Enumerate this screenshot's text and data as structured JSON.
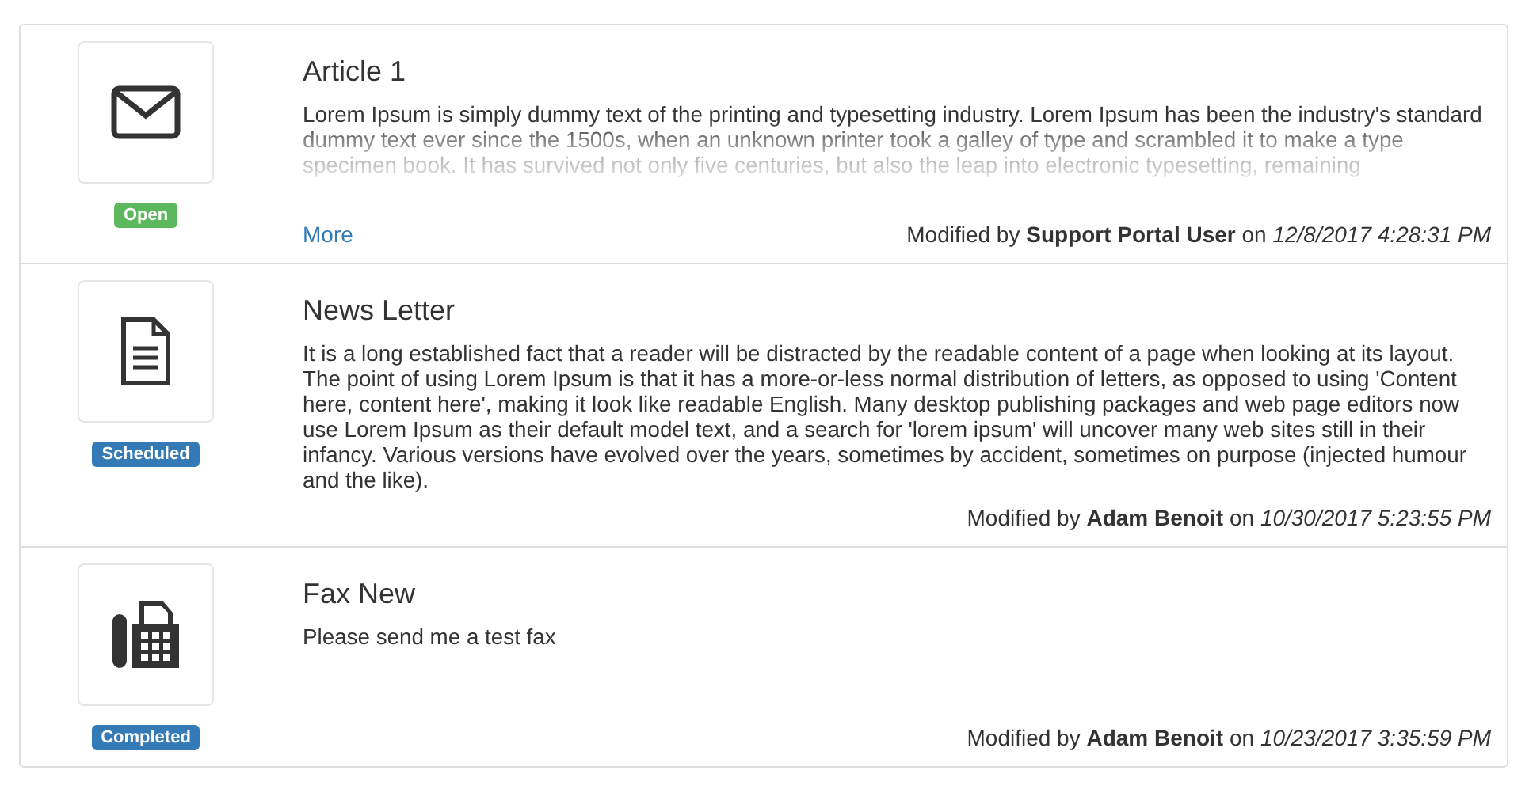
{
  "items": [
    {
      "kind": "envelope",
      "status": {
        "label": "Open",
        "kind": "open"
      },
      "title": "Article 1",
      "body": "Lorem Ipsum is simply dummy text of the printing and typesetting industry. Lorem Ipsum has been the industry's standard dummy text ever since the 1500s, when an unknown printer took a galley of type and scrambled it to make a type specimen book. It has survived not only five centuries, but also the leap into electronic typesetting, remaining",
      "collapsed": true,
      "more_link": "More",
      "modified_prefix": "Modified by",
      "author": "Support Portal User",
      "date_prefix": "on",
      "date": "12/8/2017 4:28:31 PM"
    },
    {
      "kind": "document",
      "status": {
        "label": "Scheduled",
        "kind": "scheduled"
      },
      "title": "News Letter",
      "body": "It is a long established fact that a reader will be distracted by the readable content of a page when looking at its layout. The point of using Lorem Ipsum is that it has a more-or-less normal distribution of letters, as opposed to using 'Content here, content here', making it look like readable English. Many desktop publishing packages and web page editors now use Lorem Ipsum as their default model text, and a search for 'lorem ipsum' will uncover many web sites still in their infancy. Various versions have evolved over the years, sometimes by accident, sometimes on purpose (injected humour and the like).",
      "collapsed": false,
      "modified_prefix": "Modified by",
      "author": "Adam Benoit",
      "date_prefix": "on",
      "date": "10/30/2017 5:23:55 PM"
    },
    {
      "kind": "fax",
      "status": {
        "label": "Completed",
        "kind": "completed"
      },
      "title": "Fax New",
      "body": "Please send me a test fax",
      "collapsed": false,
      "modified_prefix": "Modified by",
      "author": "Adam Benoit",
      "date_prefix": "on",
      "date": "10/23/2017 3:35:59 PM"
    }
  ]
}
